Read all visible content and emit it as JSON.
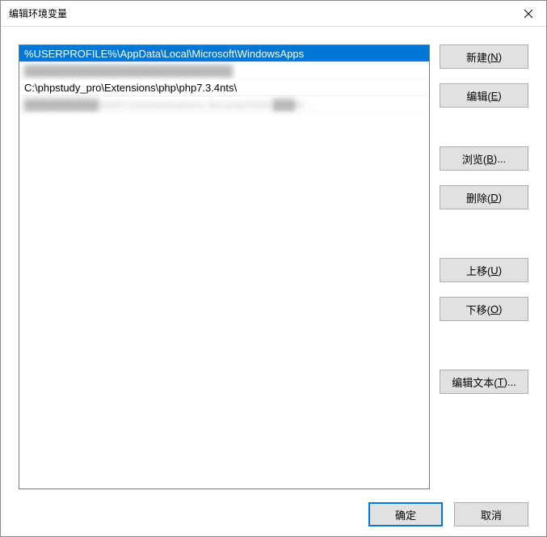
{
  "titlebar": {
    "title": "编辑环境变量",
    "close_label": "×"
  },
  "list": {
    "items": [
      {
        "text": "%USERPROFILE%\\AppData\\Local\\Microsoft\\WindowsApps",
        "selected": true,
        "blurred": false
      },
      {
        "text": "████████████████████████████",
        "selected": false,
        "blurred": true
      },
      {
        "text": "C:\\phpstudy_pro\\Extensions\\php\\php7.3.4nts\\",
        "selected": false,
        "blurred": false
      },
      {
        "text": "██████████\\SSH Communications Security\\SSH ███re …",
        "selected": false,
        "blurred": true
      }
    ]
  },
  "buttons": {
    "new": {
      "label": "新建(",
      "accel": "N",
      "suffix": ")"
    },
    "edit": {
      "label": "编辑(",
      "accel": "E",
      "suffix": ")"
    },
    "browse": {
      "label": "浏览(",
      "accel": "B",
      "suffix": ")..."
    },
    "delete": {
      "label": "删除(",
      "accel": "D",
      "suffix": ")"
    },
    "moveup": {
      "label": "上移(",
      "accel": "U",
      "suffix": ")"
    },
    "movedown": {
      "label": "下移(",
      "accel": "O",
      "suffix": ")"
    },
    "edittext": {
      "label": "编辑文本(",
      "accel": "T",
      "suffix": ")..."
    }
  },
  "footer": {
    "ok": "确定",
    "cancel": "取消"
  }
}
